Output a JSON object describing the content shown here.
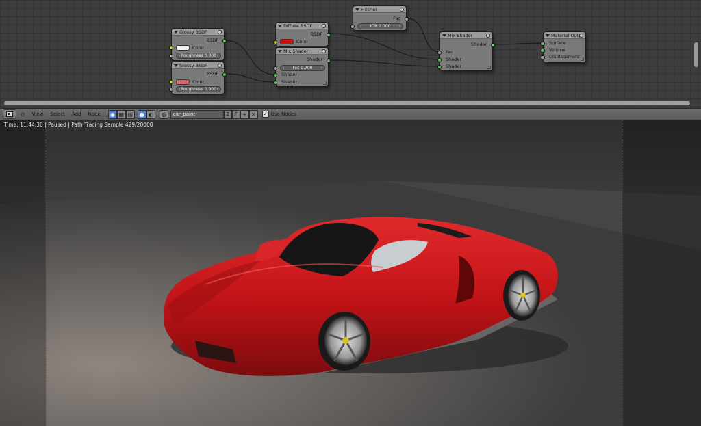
{
  "nodes": {
    "glossy1": {
      "title": "Glossy BSDF",
      "output": "BSDF",
      "color_label": "Color",
      "field": "Roughness 0.000",
      "color": "#f2eeec"
    },
    "glossy2": {
      "title": "Glossy BSDF",
      "output": "BSDF",
      "color_label": "Color",
      "field": "Roughness 0.300",
      "color": "#d86870"
    },
    "diffuse": {
      "title": "Diffuse BSDF",
      "output": "BSDF",
      "color_label": "Color",
      "color": "#cc1010"
    },
    "mix1": {
      "title": "Mix Shader",
      "output": "Shader",
      "field": "Fac 0.700",
      "in1": "Shader",
      "in2": "Shader"
    },
    "fresnel": {
      "title": "Fresnel",
      "output": "Fac",
      "field": "IOR 2.000"
    },
    "mix2": {
      "title": "Mix Shader",
      "output": "Shader",
      "in_fac": "Fac",
      "in1": "Shader",
      "in2": "Shader"
    },
    "output": {
      "title": "Material Outp",
      "in1": "Surface",
      "in2": "Volume",
      "in3": "Displacement"
    }
  },
  "header": {
    "menus": [
      "View",
      "Select",
      "Add",
      "Node"
    ],
    "material_name": "car_paint",
    "users": "2",
    "fake_user": "F",
    "use_nodes_label": "Use Nodes",
    "use_nodes_checked": true
  },
  "render": {
    "status": "Time: 11:44.30 | Paused | Path Tracing Sample 429/20000",
    "car_color": "#c41418"
  }
}
